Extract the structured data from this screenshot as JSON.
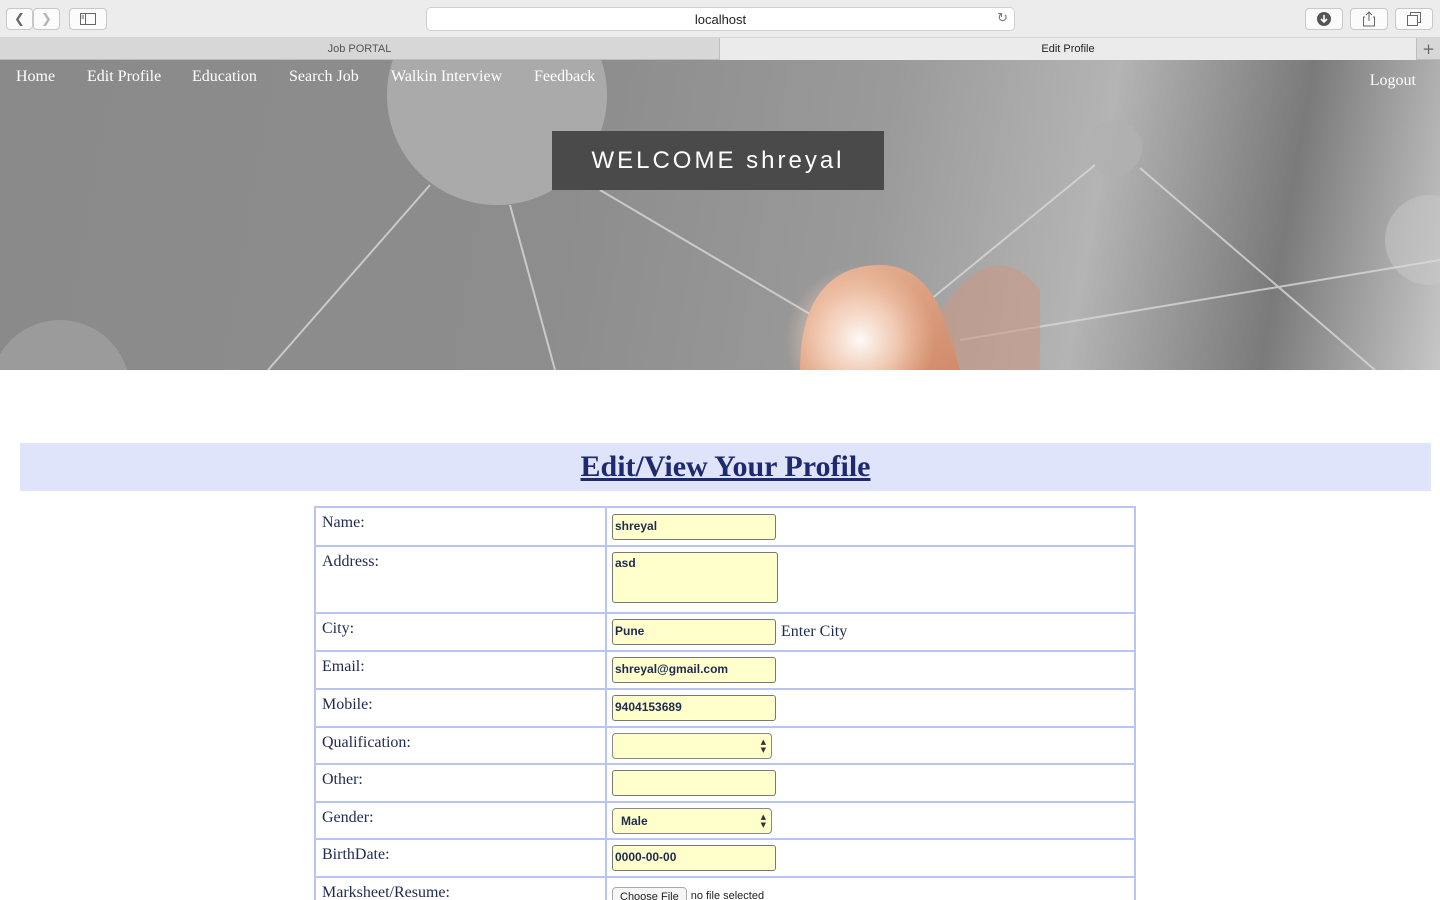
{
  "browser": {
    "url": "localhost",
    "tabs": [
      {
        "label": "Job PORTAL",
        "active": false
      },
      {
        "label": "Edit Profile",
        "active": true
      }
    ]
  },
  "nav": {
    "items": [
      "Home",
      "Edit Profile",
      "Education",
      "Search Job",
      "Walkin Interview",
      "Feedback"
    ],
    "logout": "Logout"
  },
  "hero": {
    "welcome": "WELCOME shreyal"
  },
  "page": {
    "heading": "Edit/View Your Profile"
  },
  "form": {
    "name": {
      "label": "Name:",
      "value": "shreyal"
    },
    "address": {
      "label": "Address:",
      "value": "asd"
    },
    "city": {
      "label": "City:",
      "value": "Pune",
      "hint": "Enter City"
    },
    "email": {
      "label": "Email:",
      "value": "shreyal@gmail.com"
    },
    "mobile": {
      "label": "Mobile:",
      "value": "9404153689"
    },
    "qualification": {
      "label": "Qualification:",
      "value": ""
    },
    "other": {
      "label": "Other:",
      "value": ""
    },
    "gender": {
      "label": "Gender:",
      "value": "Male"
    },
    "birthdate": {
      "label": "BirthDate:",
      "value": "0000-00-00"
    },
    "resume": {
      "label": "Marksheet/Resume:",
      "button": "Choose File",
      "status": "no file selected"
    }
  },
  "colors": {
    "heading_bar": "#dfe4fb",
    "heading_text": "#1e2a6e",
    "input_bg": "#ffffcc",
    "table_border": "#b9c5f0",
    "welcome_bg": "#4a4a4a"
  }
}
